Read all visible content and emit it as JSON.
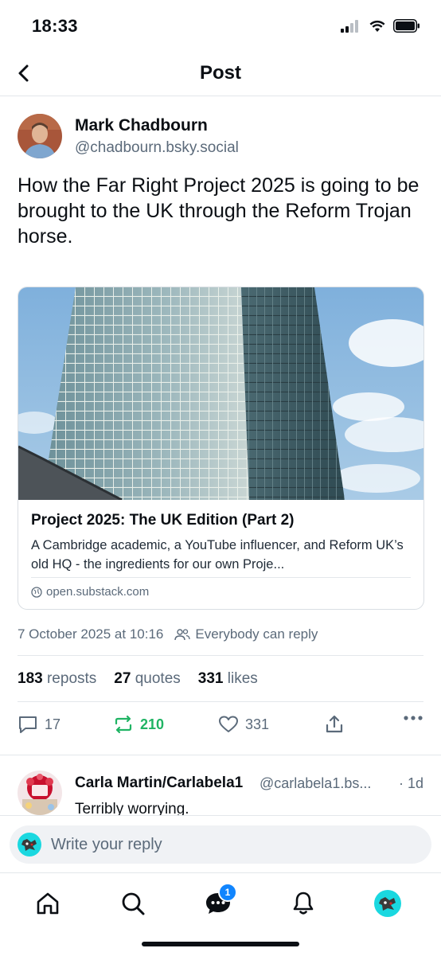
{
  "status_bar": {
    "time": "18:33"
  },
  "header": {
    "title": "Post"
  },
  "post": {
    "author_name": "Mark Chadbourn",
    "author_handle": "@chadbourn.bsky.social",
    "text": "How the Far Right Project 2025 is going to be brought to the UK through the Reform Trojan horse.",
    "link_card": {
      "title": "Project 2025: The UK Edition (Part 2)",
      "description": "A Cambridge academic, a YouTube influencer, and Reform UK’s old HQ - the ingredients for our own Proje...",
      "domain": "open.substack.com"
    },
    "timestamp": "7 October 2025 at 10:16",
    "reply_setting": "Everybody can reply",
    "stats": {
      "reposts_count": "183",
      "reposts_label": "reposts",
      "quotes_count": "27",
      "quotes_label": "quotes",
      "likes_count": "331",
      "likes_label": "likes"
    },
    "actions": {
      "reply_count": "17",
      "repost_count": "210",
      "like_count": "331"
    }
  },
  "reply": {
    "author_name": "Carla Martin/Carlabela1",
    "author_handle": "@carlabela1.bs...",
    "time": "· 1d",
    "text": "Terribly worrying."
  },
  "composer": {
    "placeholder": "Write your reply"
  },
  "tab_bar": {
    "messages_badge": "1"
  },
  "colors": {
    "accent": "#1185fe",
    "repost_active": "#20b464",
    "muted_text": "#5b6a7a",
    "divider": "#e3e7eb"
  }
}
